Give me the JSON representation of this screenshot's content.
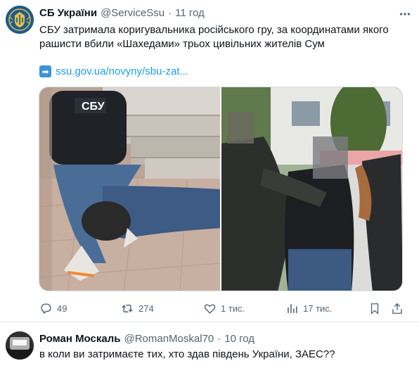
{
  "tweet": {
    "author_name": "СБ України",
    "author_handle": "@ServiceSsu",
    "separator": "·",
    "time": "11 год",
    "text": "СБУ затримала коригувальника російського гру, за координатами якого рашисти вбили «Шахедами» трьох цивільних жителів Сум",
    "link_arrow": "➡",
    "link": "ssu.gov.ua/novyny/sbu-zat...",
    "photo_left_vest_text": "СБУ",
    "actions": {
      "replies": "49",
      "retweets": "274",
      "likes": "1 тис.",
      "views": "17 тис."
    }
  },
  "reply": {
    "author_name": "Роман Москаль",
    "author_handle": "@RomanMoskal70",
    "separator": "·",
    "time": "10 год",
    "text": "в коли ви затримаєте тих, хто здав південь України, ЗАЕС??"
  },
  "colors": {
    "accent": "#1d9bf0",
    "secondary_text": "#536471",
    "primary_text": "#0f1419",
    "divider": "#e1e6ea"
  },
  "icons": [
    "ssu-emblem-avatar",
    "more-icon",
    "link-arrow-icon",
    "reply-icon",
    "retweet-icon",
    "like-icon",
    "views-icon",
    "bookmark-icon",
    "share-icon"
  ]
}
